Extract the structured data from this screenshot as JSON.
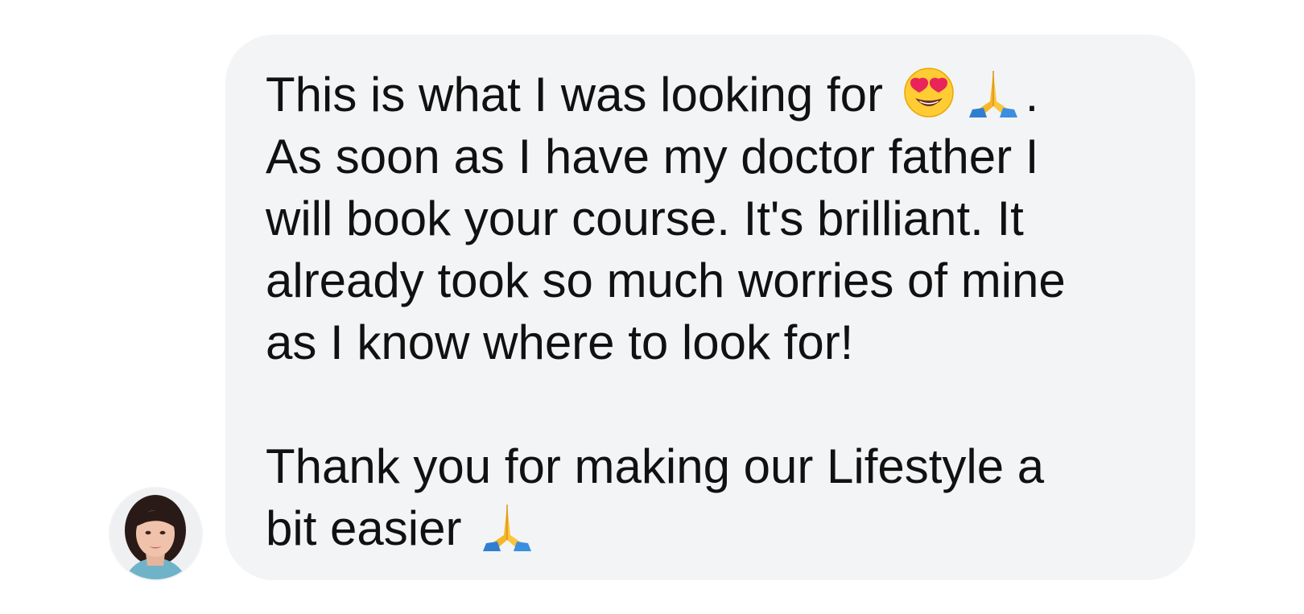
{
  "message": {
    "line1_text": "This is what I was looking for ",
    "line1_end": ".",
    "line2": "As soon as I have my doctor father I",
    "line3": "will book your course. It's brilliant. It",
    "line4": "already took so much worries of mine",
    "line5": "as I know where to look for!",
    "line6": "Thank you for making our Lifestyle a",
    "line7_text": "bit easier "
  },
  "emojis": {
    "heart_eyes": "heart-eyes-face-emoji",
    "praying_hands": "folded-hands-emoji"
  },
  "colors": {
    "bubble_bg": "#f3f4f6",
    "text": "#111111",
    "page_bg": "#ffffff"
  }
}
